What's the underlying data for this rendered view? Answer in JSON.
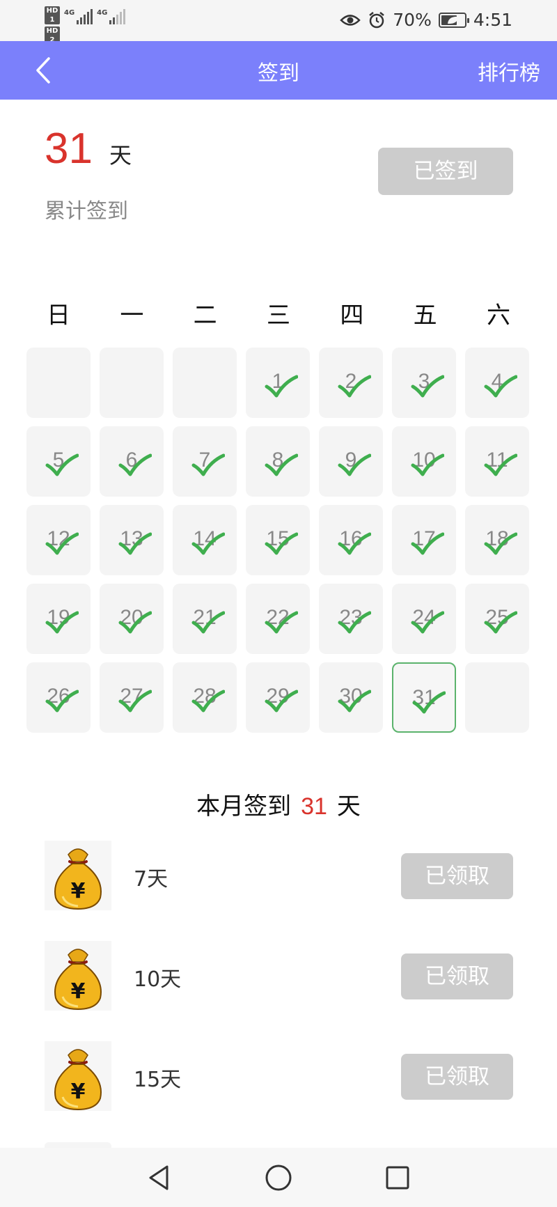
{
  "status_bar": {
    "sim1": "HD 1",
    "sim2": "HD 2",
    "network1": "4G",
    "network2": "4G",
    "battery_percent": "70%",
    "battery_level": 0.7,
    "time": "4:51",
    "icons": [
      "eye-icon",
      "alarm-icon",
      "battery-icon",
      "leaf-icon"
    ]
  },
  "header": {
    "title": "签到",
    "right_link": "排行榜",
    "bg_color": "#7b80fb"
  },
  "summary": {
    "total_days": "31",
    "unit": "天",
    "label": "累计签到",
    "button_label": "已签到"
  },
  "calendar": {
    "weekdays": [
      "日",
      "一",
      "二",
      "三",
      "四",
      "五",
      "六"
    ],
    "leading_blanks": 3,
    "days_in_month": 31,
    "signed_days": [
      1,
      2,
      3,
      4,
      5,
      6,
      7,
      8,
      9,
      10,
      11,
      12,
      13,
      14,
      15,
      16,
      17,
      18,
      19,
      20,
      21,
      22,
      23,
      24,
      25,
      26,
      27,
      28,
      29,
      30,
      31
    ],
    "today": 31,
    "check_color": "#3fae4e"
  },
  "monthly": {
    "prefix": "本月签到",
    "days": "31",
    "suffix": "天"
  },
  "rewards": [
    {
      "label": "7天",
      "button": "已领取",
      "icon": "moneybag-icon"
    },
    {
      "label": "10天",
      "button": "已领取",
      "icon": "moneybag-icon"
    },
    {
      "label": "15天",
      "button": "已领取",
      "icon": "moneybag-icon"
    }
  ],
  "nav": {
    "icons": [
      "back-triangle-icon",
      "home-circle-icon",
      "recents-square-icon"
    ]
  }
}
